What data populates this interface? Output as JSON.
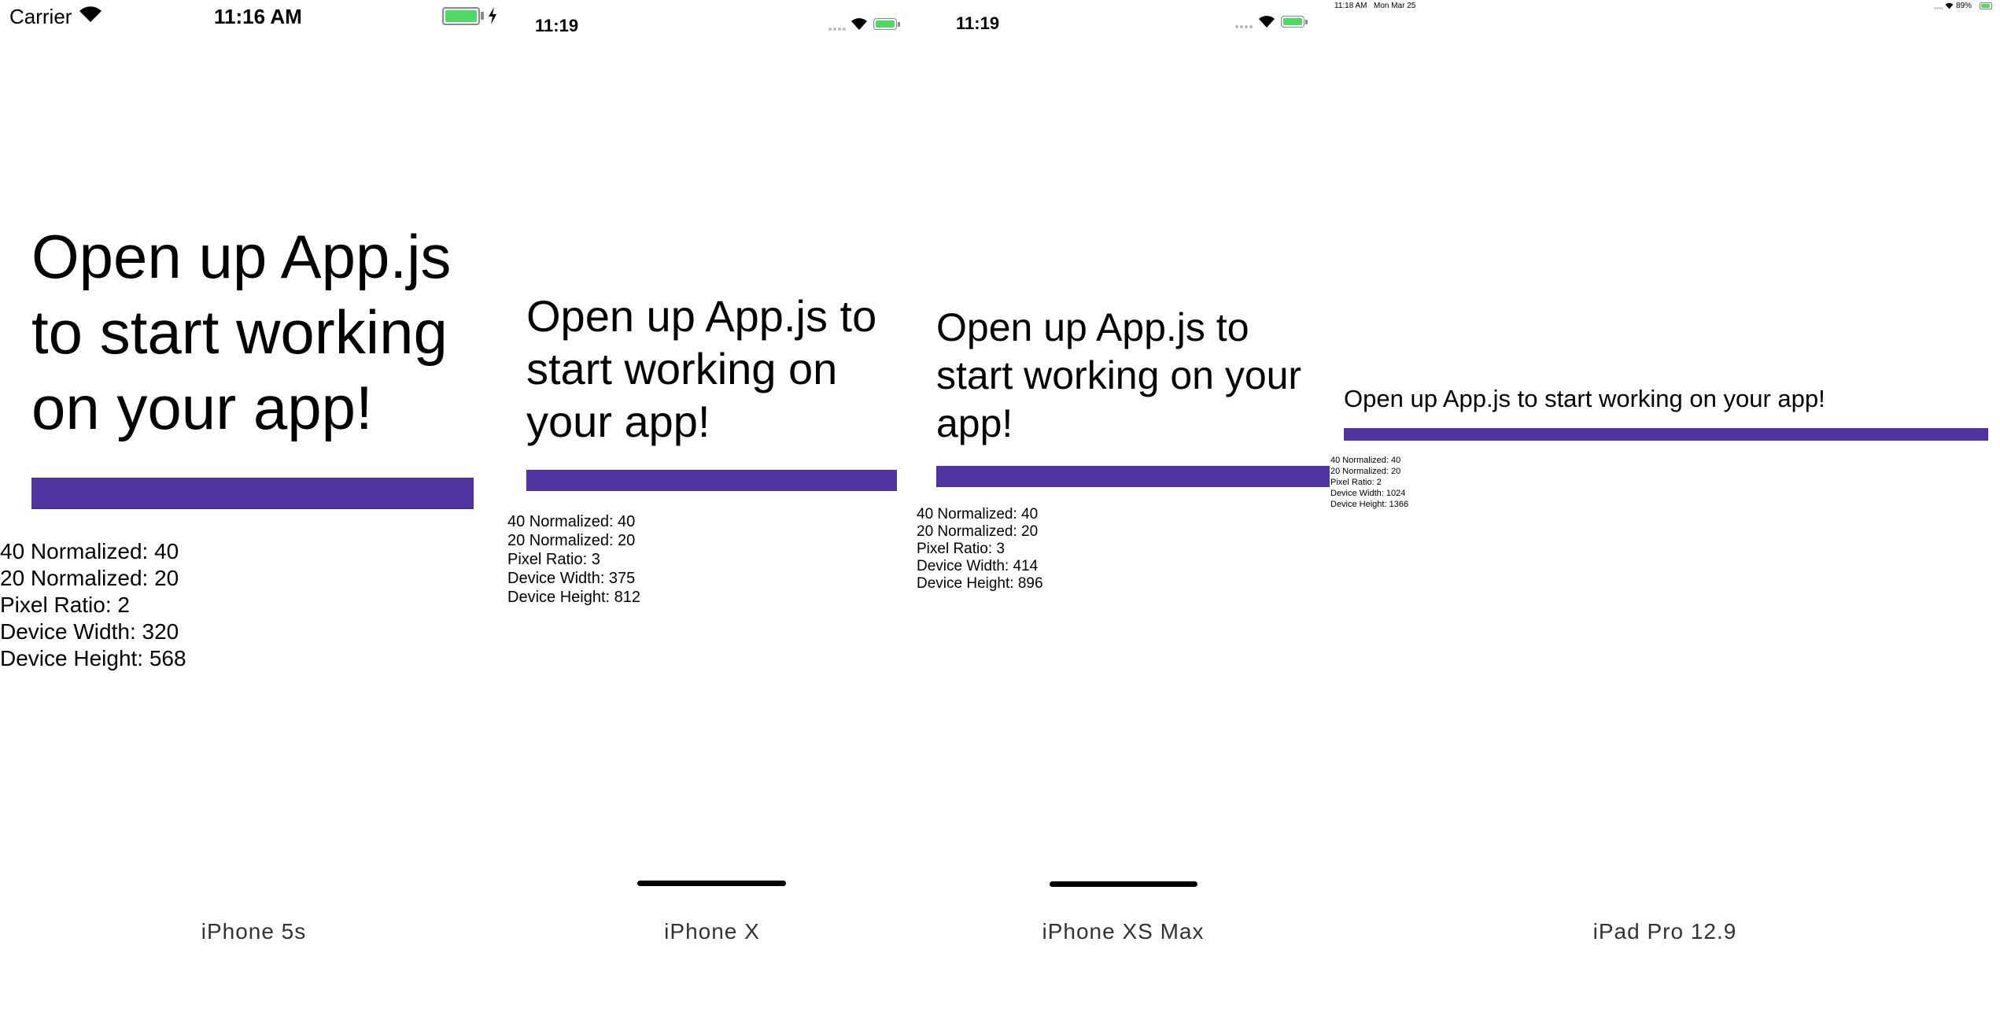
{
  "colors": {
    "accent": "#5133a0",
    "battery_green": "#4cd964",
    "caption_gray": "#333333"
  },
  "devices": [
    {
      "caption": "iPhone 5s",
      "status": {
        "carrier": "Carrier",
        "time": "11:16 AM"
      },
      "headline": "Open up App.js to start working on your app!",
      "stats": [
        "40 Normalized: 40",
        "20 Normalized: 20",
        "Pixel Ratio: 2",
        "Device Width: 320",
        "Device Height: 568"
      ]
    },
    {
      "caption": "iPhone X",
      "status": {
        "time": "11:19"
      },
      "headline": "Open up App.js to start working on your app!",
      "stats": [
        "40 Normalized: 40",
        "20 Normalized: 20",
        "Pixel Ratio: 3",
        "Device Width: 375",
        "Device Height: 812"
      ]
    },
    {
      "caption": "iPhone XS Max",
      "status": {
        "time": "11:19"
      },
      "headline": "Open up App.js to start working on your app!",
      "stats": [
        "40 Normalized: 40",
        "20 Normalized: 20",
        "Pixel Ratio: 3",
        "Device Width: 414",
        "Device Height: 896"
      ]
    },
    {
      "caption": "iPad Pro 12.9",
      "status": {
        "time": "11:18 AM",
        "date": "Mon Mar 25",
        "battery": "89%"
      },
      "headline": "Open up App.js to start working on your app!",
      "stats": [
        "40 Normalized: 40",
        "20 Normalized: 20",
        "Pixel Ratio: 2",
        "Device Width: 1024",
        "Device Height: 1366"
      ]
    }
  ]
}
